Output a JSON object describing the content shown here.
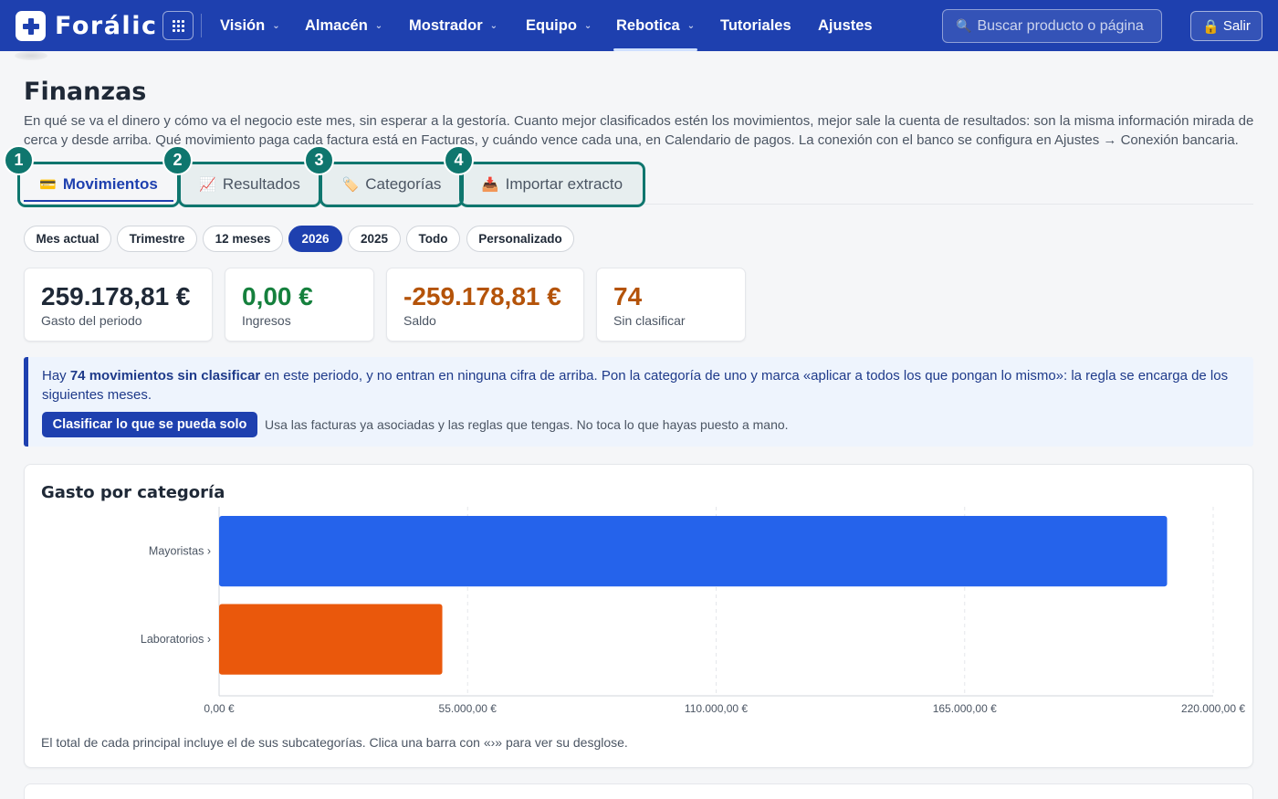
{
  "app": {
    "name": "Forálic",
    "nav": [
      {
        "label": "Visión",
        "dropdown": true
      },
      {
        "label": "Almacén",
        "dropdown": true
      },
      {
        "label": "Mostrador",
        "dropdown": true
      },
      {
        "label": "Equipo",
        "dropdown": true
      },
      {
        "label": "Rebotica",
        "dropdown": true,
        "active": true
      },
      {
        "label": "Tutoriales",
        "dropdown": false
      },
      {
        "label": "Ajustes",
        "dropdown": false
      }
    ],
    "search_placeholder": "Buscar producto o página",
    "logout_label": "Salir",
    "brand_color": "#1e40af"
  },
  "page": {
    "title": "Finanzas",
    "description": "En qué se va el dinero y cómo va el negocio este mes, sin esperar a la gestoría. Cuanto mejor clasificados estén los movimientos, mejor sale la cuenta de resultados: son la misma información mirada de cerca y desde arriba. Qué movimiento paga cada factura está en Facturas, y cuándo vence cada una, en Calendario de pagos. La conexión con el banco se configura en Ajustes → Conexión bancaria."
  },
  "tabs": [
    {
      "badge": "1",
      "icon": "💳",
      "label": "Movimientos",
      "active": true
    },
    {
      "badge": "2",
      "icon": "📈",
      "label": "Resultados",
      "active": false
    },
    {
      "badge": "3",
      "icon": "🏷️",
      "label": "Categorías",
      "active": false
    },
    {
      "badge": "4",
      "icon": "📥",
      "label": "Importar extracto",
      "active": false
    }
  ],
  "periods": [
    {
      "label": "Mes actual",
      "active": false
    },
    {
      "label": "Trimestre",
      "active": false
    },
    {
      "label": "12 meses",
      "active": false
    },
    {
      "label": "2026",
      "active": true
    },
    {
      "label": "2025",
      "active": false
    },
    {
      "label": "Todo",
      "active": false
    },
    {
      "label": "Personalizado",
      "active": false
    }
  ],
  "kpis": [
    {
      "value": "259.178,81 €",
      "label": "Gasto del periodo",
      "color": "#1f2937"
    },
    {
      "value": "0,00 €",
      "label": "Ingresos",
      "color": "#15803d"
    },
    {
      "value": "-259.178,81 €",
      "label": "Saldo",
      "color": "#b45309"
    },
    {
      "value": "74",
      "label": "Sin clasificar",
      "color": "#b45309"
    }
  ],
  "alert": {
    "prefix": "Hay ",
    "highlight": "74 movimientos sin clasificar",
    "suffix": " en este periodo, y no entran en ninguna cifra de arriba. Pon la categoría de uno y marca «aplicar a todos los que pongan lo mismo»: la regla se encarga de los siguientes meses.",
    "button_label": "Clasificar lo que se pueda solo",
    "note": "Usa las facturas ya asociadas y las reglas que tengas. No toca lo que hayas puesto a mano."
  },
  "chart_card": {
    "title": "Gasto por categoría",
    "footnote": "El total de cada principal incluye el de sus subcategorías. Clica una barra con «›» para ver su desglose."
  },
  "chart_data": {
    "type": "bar",
    "orientation": "horizontal",
    "categories": [
      "Mayoristas ›",
      "Laboratorios ›"
    ],
    "values": [
      209800,
      49400
    ],
    "colors": [
      "#2563eb",
      "#ea580c"
    ],
    "xlim": [
      0,
      220000
    ],
    "xticks": [
      0,
      55000,
      110000,
      165000,
      220000
    ],
    "xtick_labels": [
      "0,00 €",
      "55.000,00 €",
      "110.000,00 €",
      "165.000,00 €",
      "220.000,00 €"
    ],
    "grid": "vertical dashed",
    "title": "Gasto por categoría"
  }
}
